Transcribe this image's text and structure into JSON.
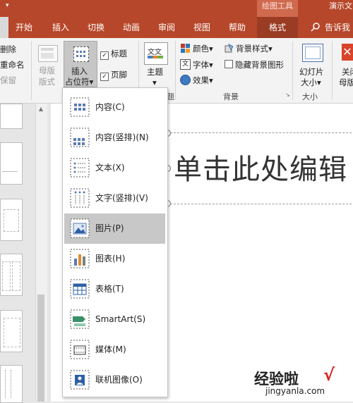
{
  "titlebar": {
    "quick_access_arrow": "▾",
    "context_tab_group": "绘图工具",
    "app_title": "演示文"
  },
  "tabs": [
    {
      "label": "开始"
    },
    {
      "label": "插入"
    },
    {
      "label": "切换"
    },
    {
      "label": "动画"
    },
    {
      "label": "审阅"
    },
    {
      "label": "视图"
    },
    {
      "label": "帮助"
    },
    {
      "label": "格式"
    },
    {
      "label": "告诉我"
    }
  ],
  "ribbon": {
    "delete_label": "删除",
    "rename_label": "重命名",
    "preserve_label": "保留",
    "master_layout_label": "母版\n版式",
    "master_layout_line1": "母版",
    "master_layout_line2": "版式",
    "insert_placeholder_line1": "插入",
    "insert_placeholder_line2": "占位符",
    "insert_placeholder_arrow": "▾",
    "title_checkbox": "标题",
    "footer_checkbox": "页脚",
    "theme_label": "主题",
    "theme_arrow": "▾",
    "colors_label": "颜色",
    "fonts_label": "字体",
    "effects_label": "效果",
    "bg_styles_label": "背景样式",
    "hide_bg_label": "隐藏背景图形",
    "background_group": "背景",
    "theme_group_partial": "题",
    "slide_size_line1": "幻灯片",
    "slide_size_line2": "大小",
    "size_group": "大小",
    "close_line1": "关闭",
    "close_line2": "母版视",
    "dropdown_arrow": "▾"
  },
  "canvas": {
    "title_placeholder": "单击此处编辑"
  },
  "placeholder_menu": {
    "items": [
      {
        "label": "内容(C)",
        "icon": "content-icon"
      },
      {
        "label": "内容(竖排)(N)",
        "icon": "content-vertical-icon"
      },
      {
        "label": "文本(X)",
        "icon": "text-icon"
      },
      {
        "label": "文字(竖排)(V)",
        "icon": "vertical-text-icon"
      },
      {
        "label": "图片(P)",
        "icon": "picture-icon",
        "selected": true
      },
      {
        "label": "图表(H)",
        "icon": "chart-icon"
      },
      {
        "label": "表格(T)",
        "icon": "table-icon"
      },
      {
        "label": "SmartArt(S)",
        "icon": "smartart-icon"
      },
      {
        "label": "媒体(M)",
        "icon": "media-icon"
      },
      {
        "label": "联机图像(O)",
        "icon": "online-image-icon"
      }
    ]
  },
  "watermark": {
    "line1": "经验啦",
    "check": "√",
    "line2": "jingyanla.com"
  },
  "colors": {
    "accent": "#b7472a",
    "context_tab": "#d06a4e",
    "selected_item": "#c8c8c8"
  }
}
